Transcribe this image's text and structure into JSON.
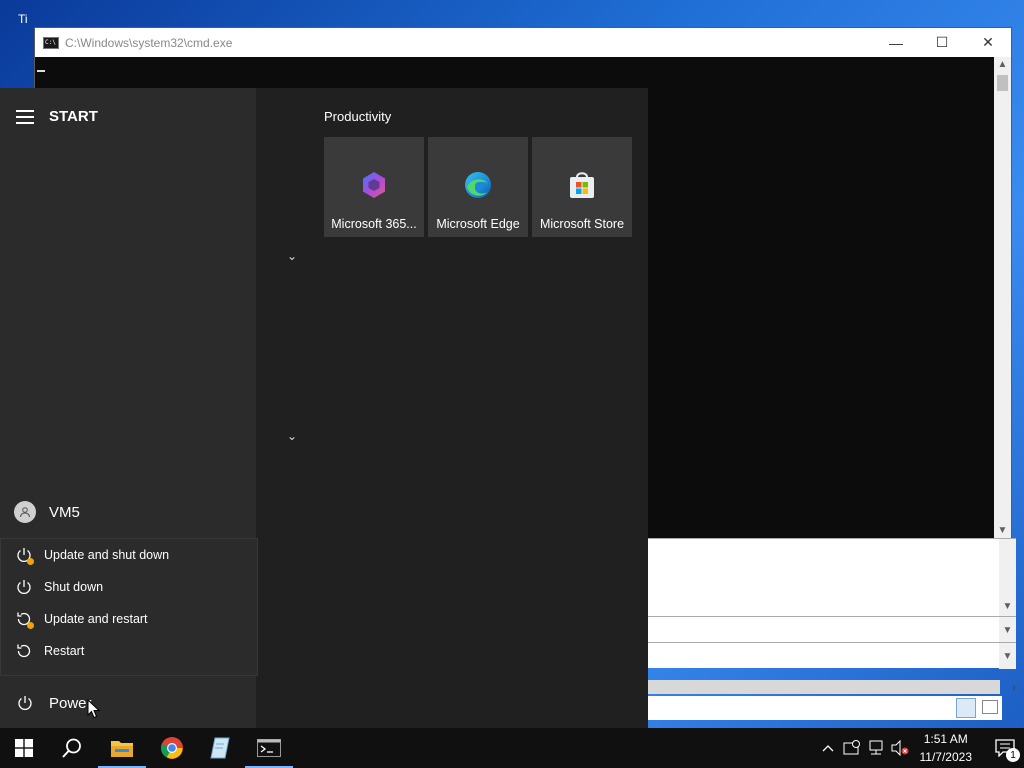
{
  "cmd_window": {
    "title": "C:\\Windows\\system32\\cmd.exe",
    "controls": {
      "minimize": "—",
      "maximize": "☐",
      "close": "✕"
    }
  },
  "desktop": {
    "icon_label": "Ti"
  },
  "start_menu": {
    "header_title": "START",
    "user_name": "VM5",
    "power_options": [
      {
        "label": "Update and shut down",
        "icon": "power-update-icon"
      },
      {
        "label": "Shut down",
        "icon": "power-icon"
      },
      {
        "label": "Update and restart",
        "icon": "restart-update-icon"
      },
      {
        "label": "Restart",
        "icon": "restart-icon"
      }
    ],
    "power_label": "Power",
    "group_label": "Productivity",
    "tiles": [
      {
        "label": "Microsoft 365...",
        "icon": "m365-icon"
      },
      {
        "label": "Microsoft Edge",
        "icon": "edge-icon"
      },
      {
        "label": "Microsoft Store",
        "icon": "store-icon"
      }
    ]
  },
  "taskbar": {
    "apps": [
      "start-button",
      "search",
      "file-explorer",
      "chrome",
      "notepad",
      "cmd"
    ],
    "clock_time": "1:51 AM",
    "clock_date": "11/7/2023",
    "notification_count": "1"
  },
  "colors": {
    "start_bg": "#202020",
    "start_left_bg": "#2b2b2b",
    "tile_bg": "#3a3a3a",
    "update_dot": "#f2a20c",
    "taskbar_bg": "#101010"
  }
}
